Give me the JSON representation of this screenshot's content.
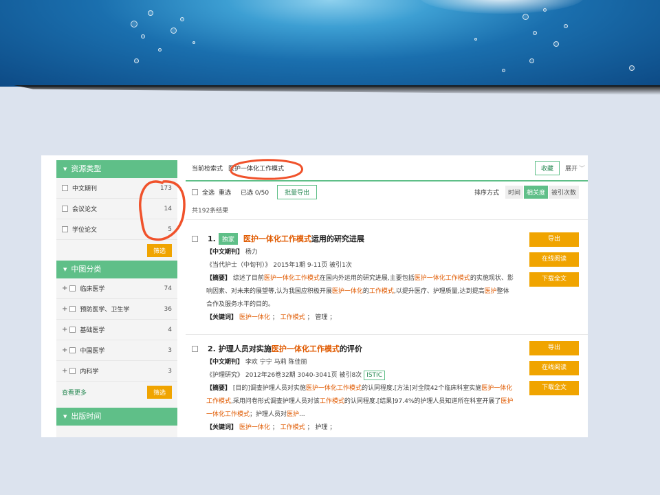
{
  "sidebar": {
    "resource_type": {
      "title": "资源类型",
      "items": [
        {
          "label": "中文期刊",
          "count": "173"
        },
        {
          "label": "会议论文",
          "count": "14"
        },
        {
          "label": "学位论文",
          "count": "5"
        }
      ],
      "filter_label": "筛选"
    },
    "clc": {
      "title": "中图分类",
      "items": [
        {
          "label": "临床医学",
          "count": "74"
        },
        {
          "label": "预防医学、卫生学",
          "count": "36"
        },
        {
          "label": "基础医学",
          "count": "4"
        },
        {
          "label": "中国医学",
          "count": "3"
        },
        {
          "label": "内科学",
          "count": "3"
        }
      ],
      "more_label": "查看更多",
      "filter_label": "筛选"
    },
    "pub_time": {
      "title": "出版时间"
    }
  },
  "query": {
    "label": "当前检索式",
    "value": "医护一体化工作模式",
    "collect_label": "收藏",
    "expand_label": "展开"
  },
  "toolbar": {
    "select_all": "全选",
    "clear": "重选",
    "selected": "已选 0/50",
    "batch_export": "批量导出",
    "sort_label": "排序方式",
    "sort_options": [
      "时间",
      "相关度",
      "被引次数"
    ]
  },
  "total": "共192条结果",
  "records": [
    {
      "index": "1.",
      "badge": "独家",
      "title_hl": "医护一体化工作模式",
      "title_rest": "运用的研究进展",
      "type_label": "【中文期刊】",
      "authors": "杨力",
      "source": "《当代护士（中旬刊）》 2015年1期 9-11页 被引1次",
      "abstract_label": "【摘要】",
      "abstract_html_1": "综述了目前",
      "abstract_hl_1": "医护一体化工作模式",
      "abstract_html_2": "在国内外运用的研究进展,主要包括",
      "abstract_hl_2": "医护一体化工作模式",
      "abstract_html_3": "的实施现状、影响因素、对未来的展望等,认为我国应积极开展",
      "abstract_hl_3": "医护一体化",
      "abstract_html_4": "的",
      "abstract_hl_4": "工作模式",
      "abstract_html_5": ",以提升医疗、护理质量,达到提高",
      "abstract_hl_5": "医护",
      "abstract_html_6": "整体合作及服务水平的目的。",
      "keywords_label": "【关键词】",
      "kw1": "医护一体化",
      "kw2": "工作模式",
      "kw3": "管理",
      "actions": [
        "导出",
        "在线阅读",
        "下载全文"
      ]
    },
    {
      "index": "2.",
      "title_pre": "护理人员对实施",
      "title_hl": "医护一体化工作模式",
      "title_rest": "的评价",
      "type_label": "【中文期刊】",
      "authors": "李欢 宁宁 马莉 陈佳丽",
      "source": "《护理研究》 2012年26卷32期 3040-3041页 被引8次",
      "istic": "ISTIC",
      "abstract_label": "【摘要】",
      "abstract_html_1": "[目的]调查护理人员对实施",
      "abstract_hl_1": "医护一体化工作模式",
      "abstract_html_2": "的认同程度.[方法]对全院42个临床科室实施",
      "abstract_hl_2": "医护一体化工作模式",
      "abstract_html_3": ",采用问卷形式调查护理人员对该",
      "abstract_hl_3": "工作模式",
      "abstract_html_4": "的认同程度.[结果]97.4%的护理人员知道所在科室开展了",
      "abstract_hl_4": "医护一体化工作模式",
      "abstract_html_5": "；护理人员对",
      "abstract_hl_5": "医护",
      "abstract_html_6": "...",
      "keywords_label": "【关键词】",
      "kw1": "医护一体化",
      "kw2": "工作模式",
      "kw3": "护理",
      "actions": [
        "导出",
        "在线阅读",
        "下载全文"
      ]
    }
  ],
  "colors": {
    "accent_green": "#5fbf88",
    "accent_orange": "#f0a400",
    "highlight": "#e05a00",
    "annotation_red": "#f0522b"
  }
}
